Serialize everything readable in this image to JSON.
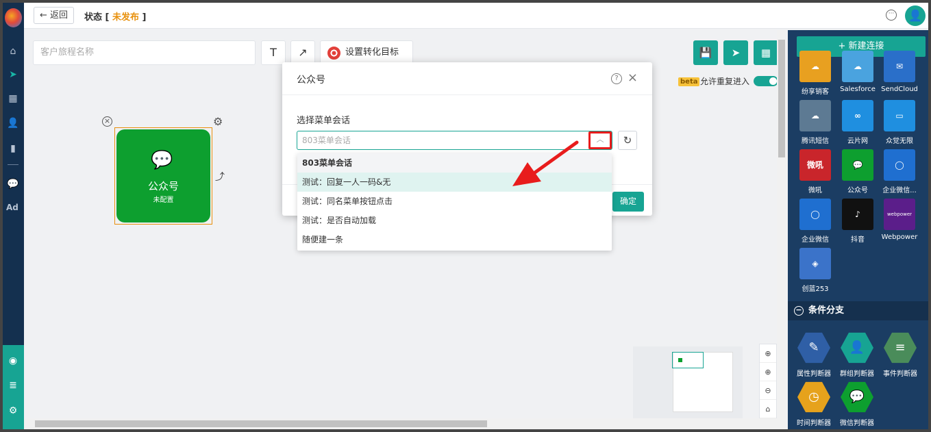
{
  "topbar": {
    "back_label": "← 返回",
    "status_prefix": "状态 [ ",
    "status_value": "未发布",
    "status_suffix": " ]",
    "avatar_glyph": "👤"
  },
  "toolbar": {
    "journey_placeholder": "客户旅程名称",
    "text_tool": "T",
    "arrow_tool": "↗",
    "target_label": "设置转化目标",
    "save_glyph": "💾",
    "send_glyph": "➤",
    "layout_glyph": "▦",
    "beta": "beta",
    "repeat_label": "允许重复进入",
    "repeat_enabled": true
  },
  "canvas": {
    "node_title": "公众号",
    "node_subtitle": "未配置",
    "node_close": "×",
    "node_gear": "⚙",
    "node_icon": "💬",
    "connector": "⤴"
  },
  "zoom": {
    "locate": "⊕",
    "zoom_in": "⊕",
    "zoom_out": "⊖",
    "fit": "⌂"
  },
  "right_panel": {
    "new_connection": "+ 新建连接",
    "tiles": [
      {
        "label": "纷享销客",
        "glyph": "☁",
        "color": "#e8a020"
      },
      {
        "label": "Salesforce",
        "glyph": "☁",
        "color": "#4aa3df"
      },
      {
        "label": "SendCloud",
        "glyph": "✉",
        "color": "#2a6fc9"
      },
      {
        "label": "腾讯短信",
        "glyph": "☁",
        "color": "#5d7a93"
      },
      {
        "label": "云片网",
        "glyph": "∞",
        "color": "#1f8fe0"
      },
      {
        "label": "众觉无限",
        "glyph": "▭",
        "color": "#1f8fe0"
      },
      {
        "label": "微吼",
        "glyph": "微吼",
        "color": "#c9252b"
      },
      {
        "label": "公众号",
        "glyph": "💬",
        "color": "#0d9f2f"
      },
      {
        "label": "企业微信...",
        "glyph": "◯",
        "color": "#1f6fd0"
      },
      {
        "label": "企业微信",
        "glyph": "◯",
        "color": "#1f6fd0"
      },
      {
        "label": "抖音",
        "glyph": "♪",
        "color": "#111111"
      },
      {
        "label": "Webpower",
        "glyph": "webpower",
        "color": "#5b1e8a"
      },
      {
        "label": "创蓝253",
        "glyph": "◈",
        "color": "#3b73c9"
      }
    ],
    "section_title": "条件分支",
    "section_toggle": "−",
    "branches": [
      {
        "label": "属性判断器",
        "glyph": "✎",
        "color": "#2f5fa6"
      },
      {
        "label": "群组判断器",
        "glyph": "👤",
        "color": "#17a493"
      },
      {
        "label": "事件判断器",
        "glyph": "≡",
        "color": "#4a8c5a"
      },
      {
        "label": "时间判断器",
        "glyph": "◷",
        "color": "#e6a21c"
      },
      {
        "label": "微信判断器",
        "glyph": "💬",
        "color": "#0d9f2f"
      }
    ]
  },
  "modal": {
    "title": "公众号",
    "help": "?",
    "close": "×",
    "field_label": "选择菜单会话",
    "select_placeholder": "803菜单会话",
    "arrow_glyph": "︿",
    "refresh_glyph": "↻",
    "ok_label": "确定"
  },
  "dropdown": {
    "group": "803菜单会话",
    "items": [
      "测试：回复一人一码&无",
      "测试：同名菜单按钮点击",
      "测试：是否自动加载",
      "随便建一条"
    ]
  }
}
